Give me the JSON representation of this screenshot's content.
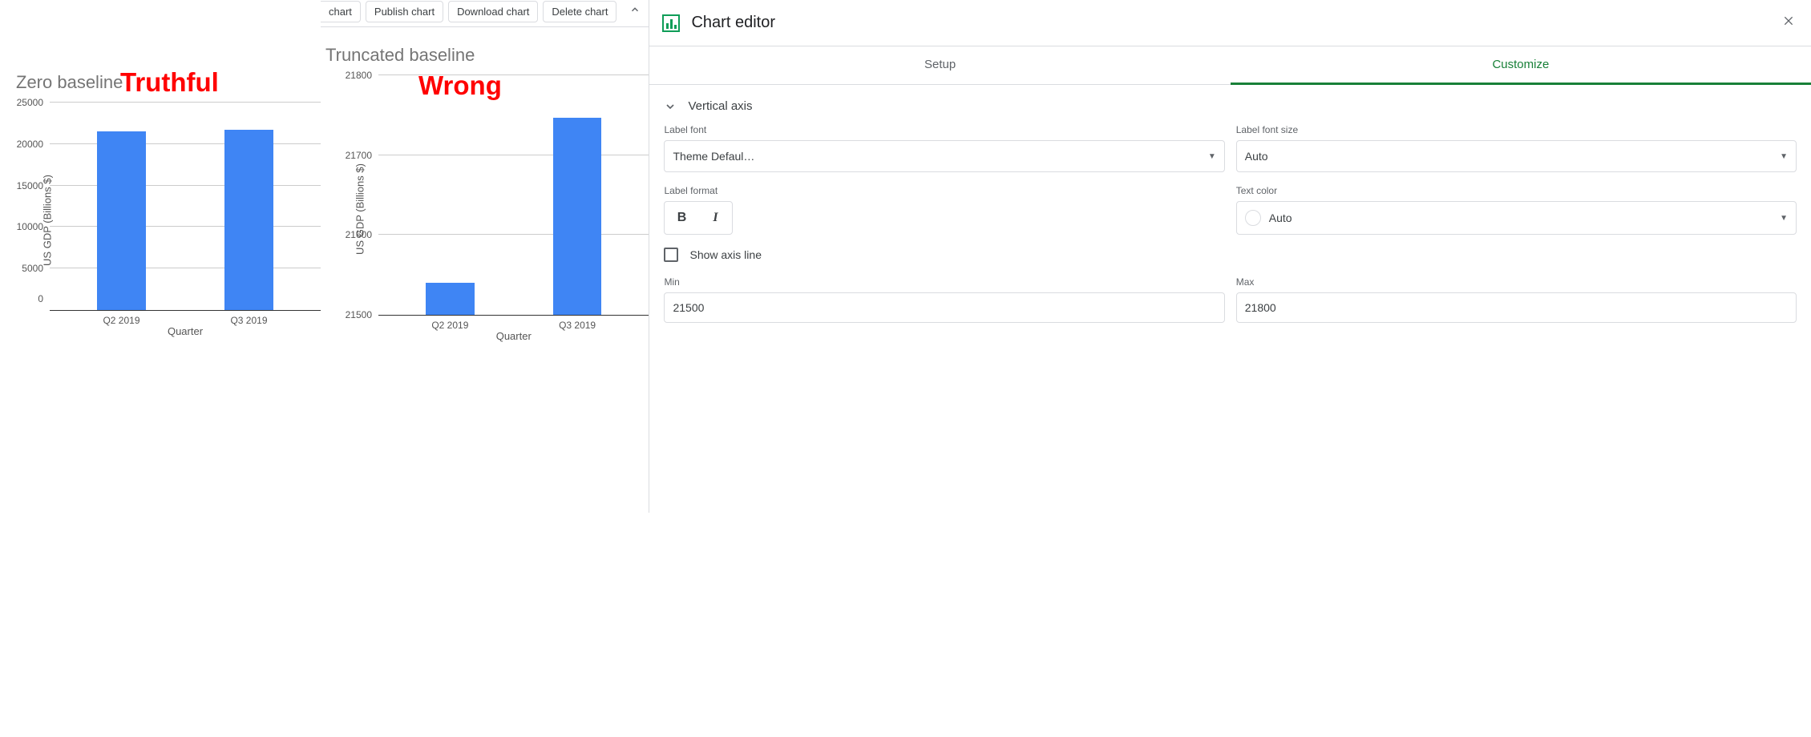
{
  "chart_data": [
    {
      "type": "bar",
      "title": "Zero baseline",
      "annotation": "Truthful",
      "categories": [
        "Q2 2019",
        "Q3 2019"
      ],
      "values": [
        21540,
        21747
      ],
      "xlabel": "Quarter",
      "ylabel": "US GDP (Billions $)",
      "ylim": [
        0,
        25000
      ],
      "yticks": [
        0,
        5000,
        10000,
        15000,
        20000,
        25000
      ]
    },
    {
      "type": "bar",
      "title": "Truncated baseline",
      "annotation": "Wrong",
      "categories": [
        "Q2 2019",
        "Q3 2019"
      ],
      "values": [
        21540,
        21747
      ],
      "xlabel": "Quarter",
      "ylabel": "US GDP (Billions $)",
      "ylim": [
        21500,
        21800
      ],
      "yticks": [
        21500,
        21600,
        21700,
        21800
      ]
    }
  ],
  "toolbar": {
    "btn0_partial": "chart",
    "btn1": "Publish chart",
    "btn2": "Download chart",
    "btn3": "Delete chart"
  },
  "editor": {
    "title": "Chart editor",
    "tabs": {
      "setup": "Setup",
      "customize": "Customize"
    },
    "section_title": "Vertical axis",
    "label_font": {
      "label": "Label font",
      "value": "Theme Defaul…"
    },
    "label_font_size": {
      "label": "Label font size",
      "value": "Auto"
    },
    "label_format": {
      "label": "Label format"
    },
    "text_color": {
      "label": "Text color",
      "value": "Auto"
    },
    "show_axis_line": "Show axis line",
    "min": {
      "label": "Min",
      "value": "21500"
    },
    "max": {
      "label": "Max",
      "value": "21800"
    }
  }
}
